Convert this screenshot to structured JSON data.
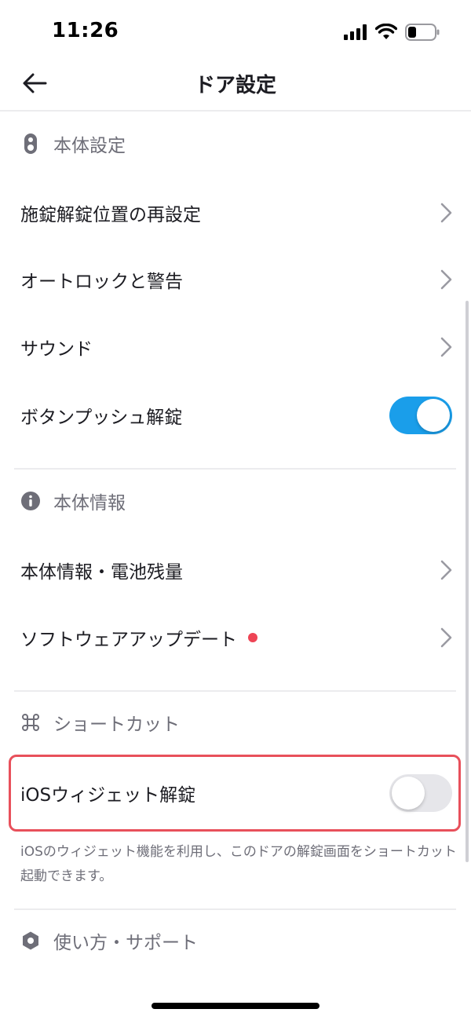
{
  "status_bar": {
    "time": "11:26"
  },
  "nav": {
    "title": "ドア設定"
  },
  "sections": {
    "device_settings": {
      "header": "本体設定",
      "rows": {
        "lock_position": "施錠解錠位置の再設定",
        "autolock": "オートロックと警告",
        "sound": "サウンド",
        "button_push": "ボタンプッシュ解錠"
      },
      "button_push_enabled": true
    },
    "device_info": {
      "header": "本体情報",
      "rows": {
        "info_battery": "本体情報・電池残量",
        "software_update": "ソフトウェアアップデート"
      },
      "software_update_badge": true
    },
    "shortcut": {
      "header": "ショートカット",
      "rows": {
        "ios_widget": "iOSウィジェット解錠"
      },
      "ios_widget_enabled": false,
      "note": "iOSのウィジェット機能を利用し、このドアの解錠画面をショートカット起動できます。"
    },
    "support": {
      "header": "使い方・サポート"
    }
  },
  "colors": {
    "accent": "#1a9eea",
    "highlight": "#e8505b",
    "badge": "#ee4455",
    "secondary_text": "#6e6e78"
  },
  "icons": {
    "device": "smart-lock-icon",
    "info": "info-icon",
    "shortcut": "command-icon",
    "support": "hexagon-icon",
    "back": "arrow-left-icon",
    "chevron": "chevron-right-icon"
  }
}
